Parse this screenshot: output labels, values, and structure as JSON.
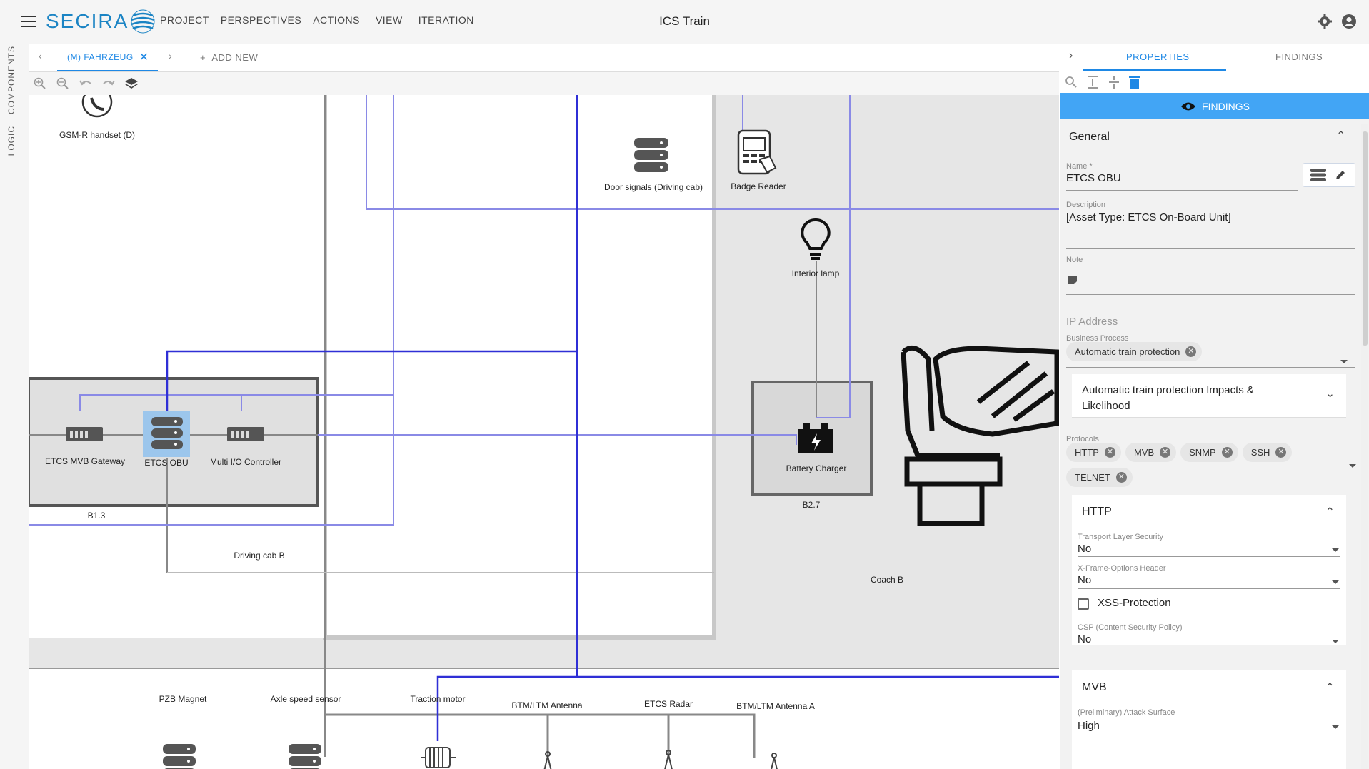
{
  "app": {
    "logo": "SECIRA",
    "title": "ICS Train",
    "menu": [
      "PROJECT",
      "PERSPECTIVES",
      "ACTIONS",
      "VIEW",
      "ITERATION"
    ]
  },
  "left_rail": {
    "components": "COMPONENTS",
    "logic": "LOGIC"
  },
  "tabs": {
    "active": "(M) FAHRZEUG",
    "add_new": "ADD NEW"
  },
  "diagram": {
    "nodes": {
      "gsm": "GSM-R handset (D)",
      "door": "Door signals (Driving cab)",
      "badge": "Badge Reader",
      "lamp": "Interior lamp",
      "mvb_gw": "ETCS MVB Gateway",
      "etcs_obu": "ETCS OBU",
      "multi_io": "Multi I/O Controller",
      "battery": "Battery Charger",
      "pzb": "PZB Magnet",
      "axle": "Axle speed sensor",
      "traction": "Traction motor",
      "btm": "BTM/LTM Antenna",
      "radar": "ETCS Radar",
      "btm_a": "BTM/LTM Antenna A"
    },
    "zones": {
      "b13": "B1.3",
      "b27": "B2.7",
      "driving_cab": "Driving cab B",
      "coach": "Coach B"
    },
    "colors": {
      "bus_dark": "#2f2fd6",
      "bus_light": "#8a8ae6",
      "wire": "#777777",
      "zone_bg": "#e6e6e6"
    }
  },
  "panel": {
    "tabs": {
      "properties": "PROPERTIES",
      "findings": "FINDINGS"
    },
    "findings_button": "FINDINGS",
    "general": {
      "title": "General",
      "name_label": "Name *",
      "name_value": "ETCS OBU",
      "description_label": "Description",
      "description_value": "[Asset Type: ETCS On-Board Unit]",
      "note_label": "Note",
      "ip_placeholder": "IP Address",
      "business_label": "Business Process",
      "business_chip": "Automatic train protection",
      "impacts_title": "Automatic train protection Impacts & Likelihood",
      "protocols_label": "Protocols",
      "protocols": [
        "HTTP",
        "MVB",
        "SNMP",
        "SSH",
        "TELNET"
      ]
    },
    "http": {
      "title": "HTTP",
      "tls_label": "Transport Layer Security",
      "tls_value": "No",
      "xframe_label": "X-Frame-Options Header",
      "xframe_value": "No",
      "xss_label": "XSS-Protection",
      "csp_label": "CSP (Content Security Policy)",
      "csp_value": "No"
    },
    "mvb": {
      "title": "MVB",
      "attack_label": "(Preliminary) Attack Surface",
      "attack_value": "High"
    }
  }
}
